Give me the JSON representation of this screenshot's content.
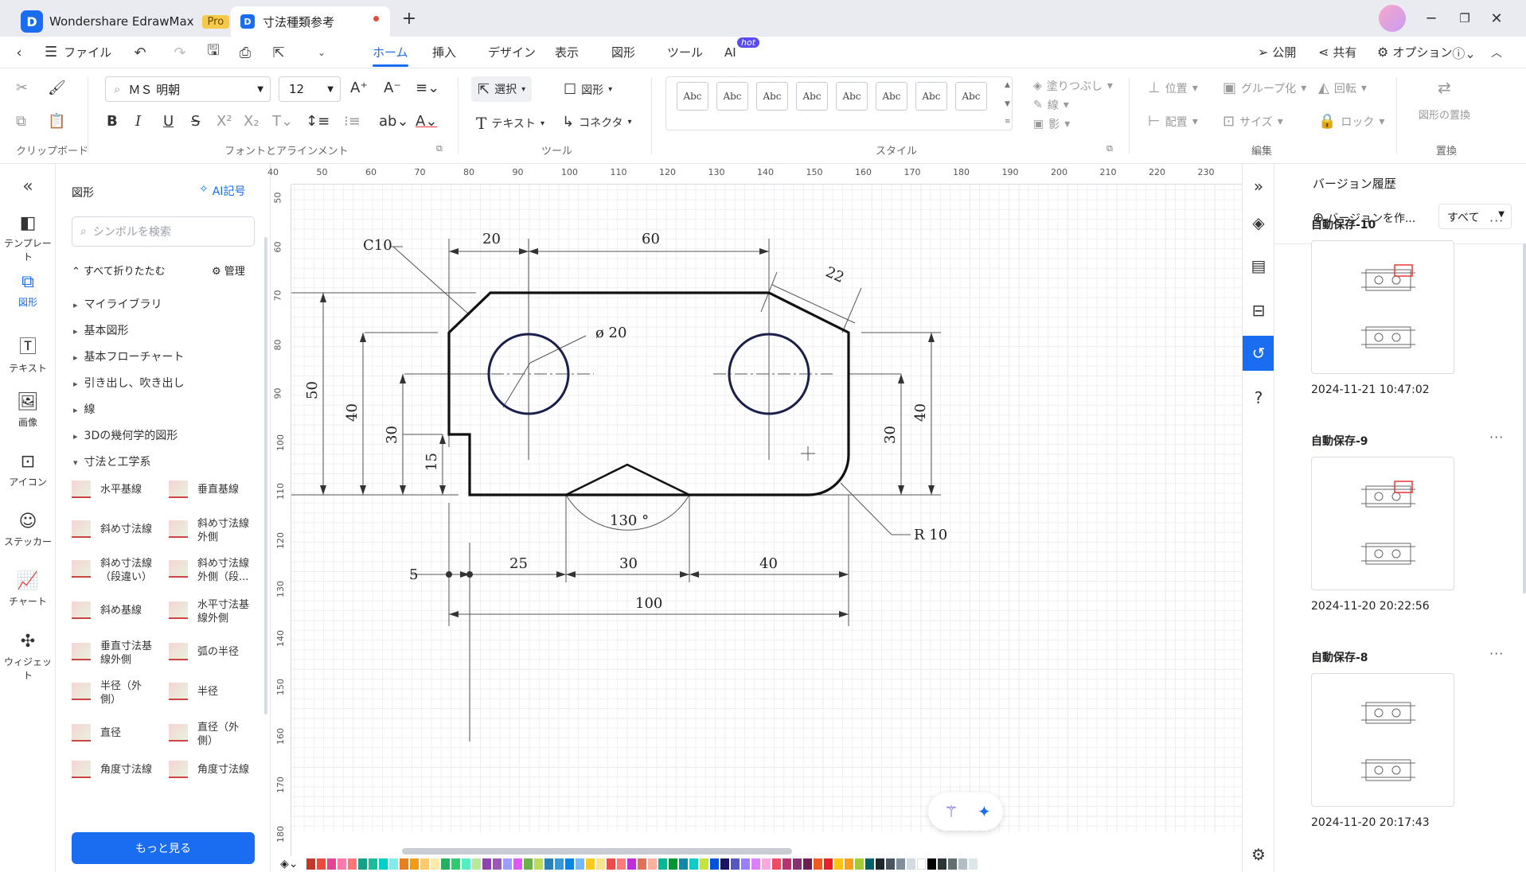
{
  "titlebar": {
    "app_name": "Wondershare EdrawMax",
    "pro_badge": "Pro",
    "doc_tab": "寸法種類参考",
    "new_tab": "+"
  },
  "menubar": {
    "file": "ファイル",
    "tabs": [
      "ホーム",
      "挿入",
      "デザイン",
      "表示",
      "図形",
      "ツール",
      "AI"
    ],
    "ai_badge": "hot",
    "publish": "公開",
    "share": "共有",
    "options": "オプション"
  },
  "ribbon": {
    "font_name": "ＭＳ 明朝",
    "font_size": "12",
    "select": "選択",
    "shape": "図形",
    "text": "テキスト",
    "connector": "コネクタ",
    "style_sample": "Abc",
    "fill": "塗りつぶし",
    "line": "線",
    "shadow": "影",
    "position": "位置",
    "group": "グループ化",
    "rotate": "回転",
    "align": "配置",
    "size": "サイズ",
    "lock": "ロック",
    "replace_shape": "図形の置換",
    "groups": {
      "clipboard": "クリップボード",
      "font": "フォントとアラインメント",
      "tools": "ツール",
      "style": "スタイル",
      "edit": "編集",
      "replace": "置換"
    }
  },
  "leftnav": [
    {
      "label": "テンプレート",
      "icon": "template-icon"
    },
    {
      "label": "図形",
      "icon": "shapes-icon"
    },
    {
      "label": "テキスト",
      "icon": "text-icon"
    },
    {
      "label": "画像",
      "icon": "image-icon"
    },
    {
      "label": "アイコン",
      "icon": "icon-library-icon"
    },
    {
      "label": "ステッカー",
      "icon": "sticker-icon"
    },
    {
      "label": "チャート",
      "icon": "chart-icon"
    },
    {
      "label": "ウィジェット",
      "icon": "widget-icon"
    }
  ],
  "shapes_panel": {
    "title": "図形",
    "ai_symbol": "AI記号",
    "search_placeholder": "シンボルを検索",
    "collapse_all": "すべて折りたたむ",
    "manage": "管理",
    "libraries": [
      "マイライブラリ",
      "基本図形",
      "基本フローチャート",
      "引き出し、吹き出し",
      "線",
      "3Dの幾何学的図形",
      "寸法と工学系"
    ],
    "items": [
      [
        "水平基線",
        "垂直基線"
      ],
      [
        "斜め寸法線",
        "斜め寸法線\n外側"
      ],
      [
        "斜め寸法線\n（段違い）",
        "斜め寸法線\n外側（段..."
      ],
      [
        "斜め基線",
        "水平寸法基\n線外側"
      ],
      [
        "垂直寸法基\n線外側",
        "弧の半径"
      ],
      [
        "半径（外\n側）",
        "半径"
      ],
      [
        "直径",
        "直径（外\n側）"
      ],
      [
        "角度寸法線",
        "角度寸法線"
      ]
    ],
    "more": "もっと見る"
  },
  "ruler": {
    "top": [
      "40",
      "50",
      "60",
      "70",
      "80",
      "90",
      "100",
      "110",
      "120",
      "130",
      "140",
      "150",
      "160",
      "170",
      "180",
      "190",
      "200",
      "210",
      "220",
      "230"
    ],
    "left": [
      "50",
      "60",
      "70",
      "80",
      "90",
      "100",
      "110",
      "120",
      "130",
      "140",
      "150",
      "160",
      "170",
      "180"
    ]
  },
  "drawing": {
    "chamfer": "C10",
    "dim_20": "20",
    "dim_60": "60",
    "dim_22": "22",
    "diameter": "ø 20",
    "dim_50": "50",
    "dim_40_left": "40",
    "dim_30_left": "30",
    "dim_15": "15",
    "dim_30_right": "30",
    "dim_40_right": "40",
    "angle": "130 °",
    "radius": "R 10",
    "dim_5": "5",
    "dim_25": "25",
    "dim_30_bottom": "30",
    "dim_40_bottom": "40",
    "dim_100": "100"
  },
  "version_panel": {
    "title": "バージョン履歴",
    "create": "バージョンを作...",
    "filter": "すべて",
    "versions": [
      {
        "name": "自動保存-10",
        "date": "2024-11-21 10:47:02"
      },
      {
        "name": "自動保存-9",
        "date": "2024-11-20 20:22:56"
      },
      {
        "name": "自動保存-8",
        "date": "2024-11-20 20:17:43"
      }
    ]
  },
  "colors": {
    "accent": "#1a6cf0",
    "palette": [
      "#c0392b",
      "#e74c3c",
      "#e84393",
      "#fd79a8",
      "#ff7675",
      "#16a085",
      "#1abc9c",
      "#00cec9",
      "#81ecec",
      "#e67e22",
      "#f39c12",
      "#fdcb6e",
      "#ffeaa7",
      "#27ae60",
      "#2ecc71",
      "#55efc4",
      "#b8e994",
      "#8e44ad",
      "#9b59b6",
      "#a29bfe",
      "#e056fd",
      "#6ab04c",
      "#badc58",
      "#2980b9",
      "#3498db",
      "#0984e3",
      "#74b9ff",
      "#f9ca24",
      "#f6e58d",
      "#eb4d4b",
      "#ff7979",
      "#be2edd",
      "#e17055",
      "#fab1a0",
      "#00b894",
      "#009432",
      "#1289a7",
      "#12cbc4",
      "#c4e538",
      "#0652dd",
      "#1b1464",
      "#5758bb",
      "#9980fa",
      "#d980fa",
      "#fda7df",
      "#ed4c67",
      "#b53471",
      "#833471",
      "#6f1e51",
      "#ee5a24",
      "#ea2027",
      "#ffc312",
      "#f79f1f",
      "#a3cb38",
      "#006266",
      "#1e272e",
      "#485460",
      "#808e9b",
      "#d2dae2",
      "#ffffff",
      "#000000",
      "#2d3436",
      "#636e72",
      "#b2bec3",
      "#dfe6e9"
    ]
  }
}
